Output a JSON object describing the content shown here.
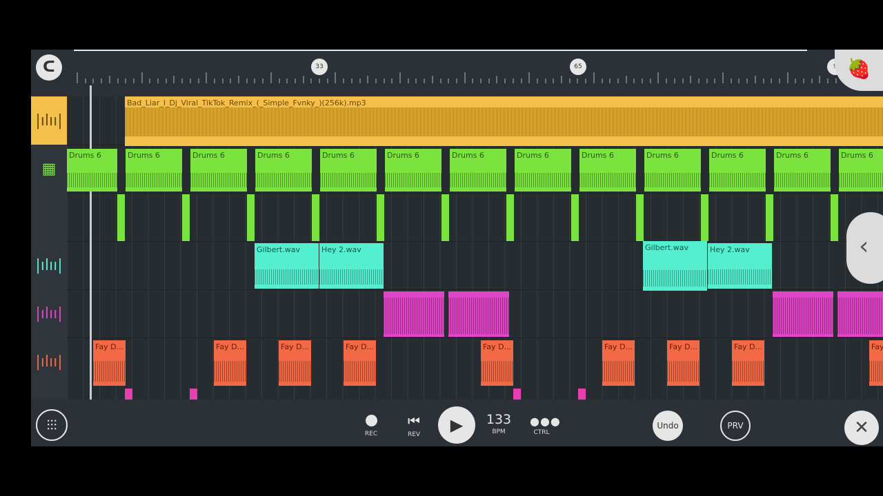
{
  "ruler": {
    "markers": [
      "33",
      "65",
      "9"
    ]
  },
  "tracks": {
    "audio_clip_name": "Bad_Liar_I_Dj_Viral_TikTok_Remix_(_Simple_Fvnky_)(256k).mp3",
    "drums_clip_name": "Drums 6",
    "gilbert_clip_name": "Gilbert.wav",
    "hey_clip_name": "Hey 2.wav",
    "fay_clip_name": "Fay D..."
  },
  "icons": {
    "logo": "logo-icon",
    "fruit": "fruit-icon",
    "waveform": "waveform-icon",
    "pattern": "pattern-icon",
    "mixer": "mixer-icon",
    "close": "close-icon",
    "back": "chevron-left-icon"
  },
  "transport": {
    "rec_label": "REC",
    "rev_label": "REV",
    "bpm_value": "133",
    "bpm_label": "BPM",
    "ctrl_label": "CTRL",
    "undo_label": "Undo",
    "prv_label": "PRV"
  },
  "colors": {
    "audio": "#f4c04a",
    "drums": "#7be33d",
    "gilbert": "#53efd0",
    "pink": "#e045c8",
    "fay": "#f26a45"
  }
}
